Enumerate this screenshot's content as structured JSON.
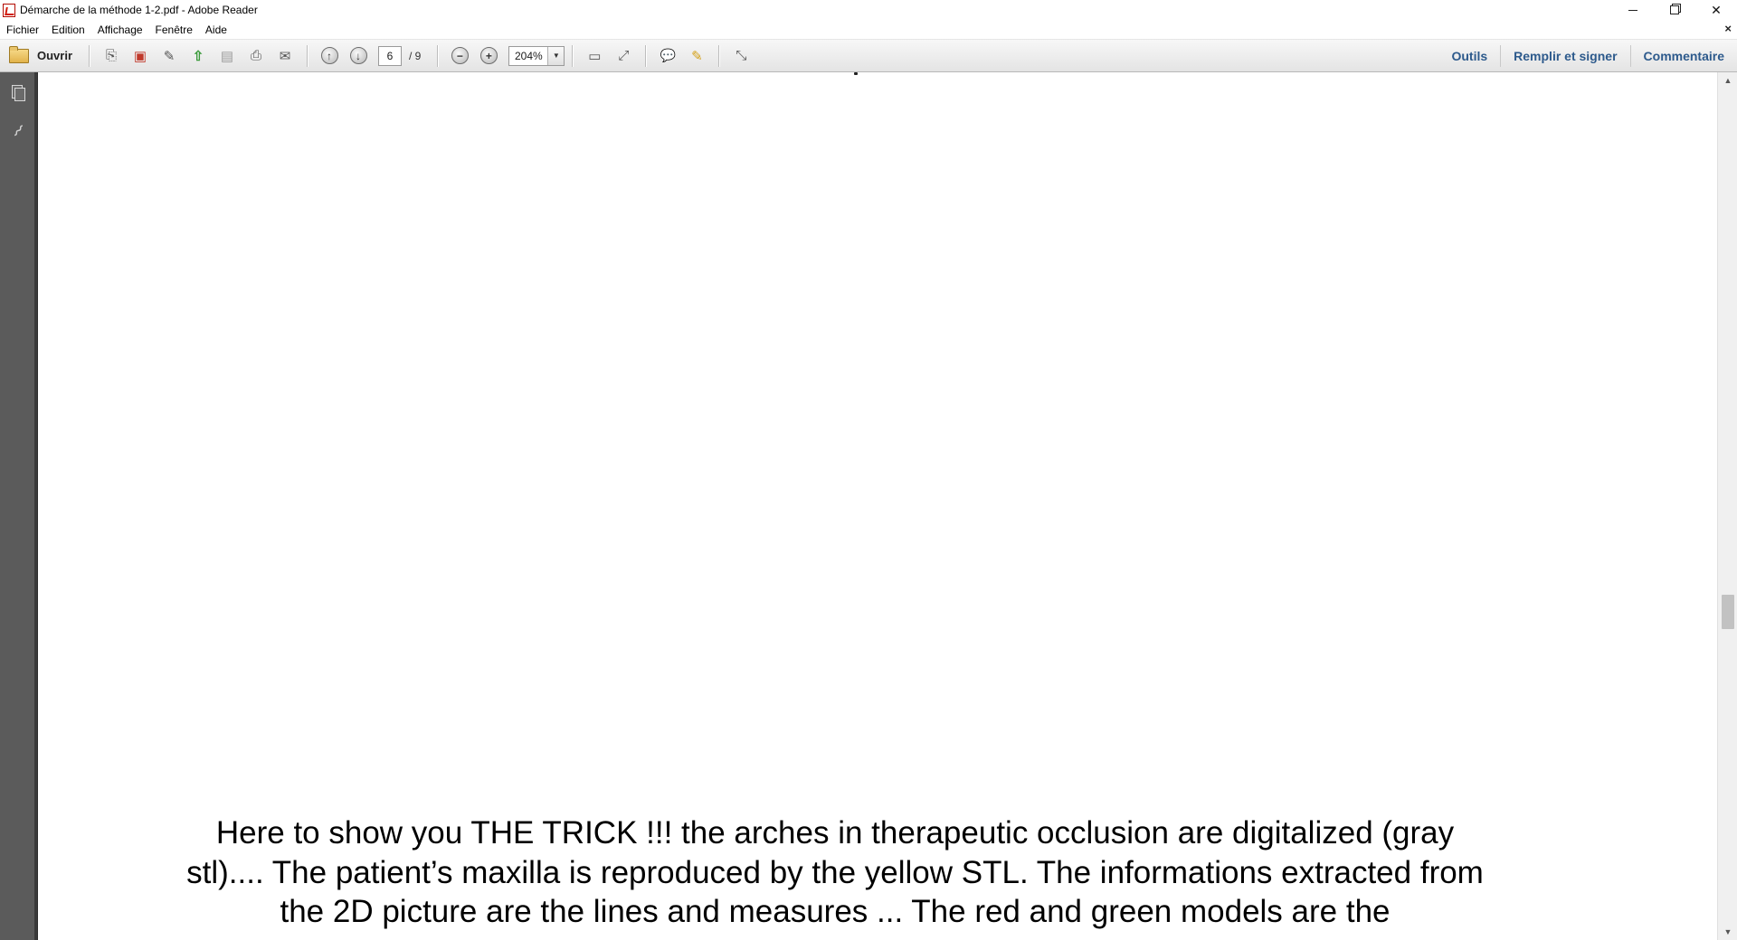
{
  "window": {
    "title": "Démarche de la méthode 1-2.pdf - Adobe Reader",
    "controls": {
      "minimize": "",
      "restore": "",
      "close": "✕"
    }
  },
  "menu": {
    "items": [
      "Fichier",
      "Edition",
      "Affichage",
      "Fenêtre",
      "Aide"
    ],
    "doc_close": "×"
  },
  "toolbar": {
    "open_label": "Ouvrir",
    "page_current": "6",
    "page_total": "/ 9",
    "zoom": "204%",
    "zoom_arrow": "▼",
    "right_links": [
      "Outils",
      "Remplir et signer",
      "Commentaire"
    ],
    "icons": {
      "create-pdf": "⎘",
      "export-pdf": "▣",
      "edit-pdf": "✎",
      "upload": "⇧",
      "save": "▤",
      "print": "⎙",
      "email": "✉",
      "prev-page": "↑",
      "next-page": "↓",
      "zoom-out": "−",
      "zoom-in": "+",
      "fit-page": "▭",
      "full-screen": "⤢",
      "comment": "💬",
      "highlight": "✎",
      "read-mode": "⤡"
    }
  },
  "document": {
    "text": "Here to show you THE TRICK !!! the arches in therapeutic occlusion are digitalized (gray stl).... The patient’s maxilla  is reproduced by the yellow STL. The informations extracted from the 2D picture are the lines and measures ... The red and green models are the"
  },
  "scrollbar": {
    "up": "▲",
    "down": "▼",
    "position_fraction": 0.62
  }
}
